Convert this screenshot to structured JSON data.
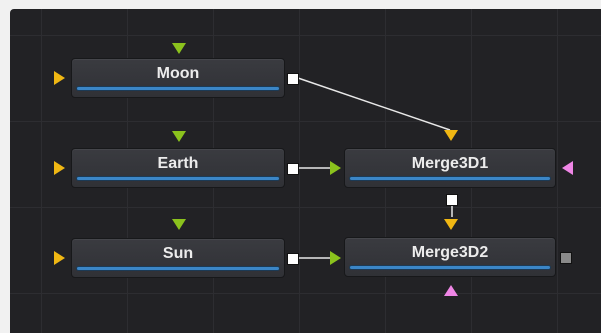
{
  "flow": {
    "nodes": {
      "moon": {
        "label": "Moon"
      },
      "earth": {
        "label": "Earth"
      },
      "sun": {
        "label": "Sun"
      },
      "merge3d1": {
        "label": "Merge3D1"
      },
      "merge3d2": {
        "label": "Merge3D2"
      }
    },
    "colors": {
      "background_port": "#f0b713",
      "foreground_port": "#8bc21d",
      "effect_mask_port": "#ef86e6",
      "output_port": "#ffffff",
      "node_status_bar": "#3b86c7",
      "canvas": "#222225"
    }
  }
}
